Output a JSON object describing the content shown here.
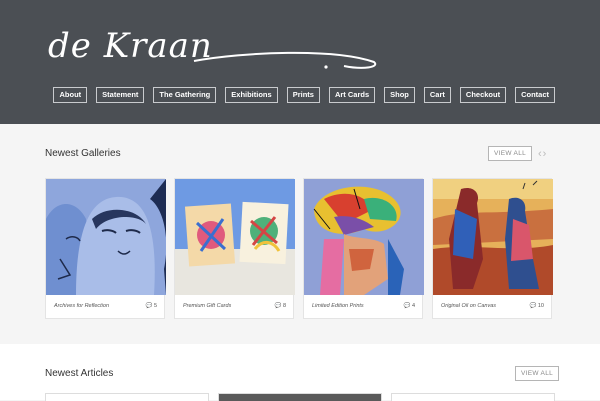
{
  "brand": {
    "logo_text": "de Kraan"
  },
  "nav": [
    "About",
    "Statement",
    "The Gathering",
    "Exhibitions",
    "Prints",
    "Art Cards",
    "Shop",
    "Cart",
    "Checkout",
    "Contact"
  ],
  "galleries": {
    "title": "Newest Galleries",
    "view_all": "VIEW ALL",
    "arrows": "‹›",
    "items": [
      {
        "caption": "Archives for Reflection",
        "count": "5"
      },
      {
        "caption": "Premium Gift Cards",
        "count": "8"
      },
      {
        "caption": "Limited Edition Prints",
        "count": "4"
      },
      {
        "caption": "Original Oil on Canvas",
        "count": "10"
      }
    ]
  },
  "articles": {
    "title": "Newest Articles",
    "view_all": "VIEW ALL"
  },
  "colors": {
    "header_bg": "#4b4f54",
    "page_bg": "#f5f5f5",
    "white": "#ffffff"
  }
}
